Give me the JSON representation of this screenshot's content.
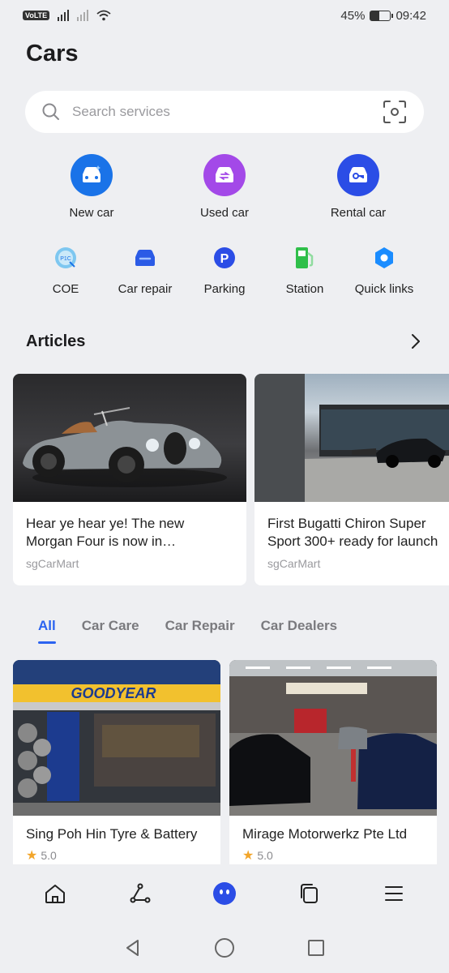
{
  "status_bar": {
    "battery_percent": "45%",
    "time": "09:42",
    "volte": "VoLTE",
    "battery_level": 0.45
  },
  "page": {
    "title": "Cars"
  },
  "search": {
    "placeholder": "Search services"
  },
  "primary_services": [
    {
      "label": "New car",
      "icon": "new-car-icon",
      "color": "#1a73e8"
    },
    {
      "label": "Used car",
      "icon": "used-car-icon",
      "color": "#a349e8"
    },
    {
      "label": "Rental car",
      "icon": "rental-car-icon",
      "color": "#2b4de6"
    }
  ],
  "secondary_services": [
    {
      "label": "COE",
      "icon": "coe-icon"
    },
    {
      "label": "Car repair",
      "icon": "car-repair-icon"
    },
    {
      "label": "Parking",
      "icon": "parking-icon"
    },
    {
      "label": "Station",
      "icon": "fuel-station-icon"
    },
    {
      "label": "Quick links",
      "icon": "quick-links-icon"
    }
  ],
  "articles": {
    "title": "Articles",
    "items": [
      {
        "title_line1": "Hear ye hear ye! The new",
        "title_line2": "Morgan Four is now in…",
        "source": "sgCarMart"
      },
      {
        "title_line1": "First Bugatti Chiron Super",
        "title_line2": "Sport 300+ ready for launch",
        "source": "sgCarMart"
      }
    ]
  },
  "tabs": [
    {
      "label": "All",
      "active": true
    },
    {
      "label": "Car Care"
    },
    {
      "label": "Car Repair"
    },
    {
      "label": "Car Dealers"
    }
  ],
  "shops": [
    {
      "name": "Sing Poh Hin Tyre & Battery",
      "rating": "5.0",
      "sign_text": "GOODYEAR"
    },
    {
      "name": "Mirage Motorwerkz Pte Ltd",
      "rating": "5.0"
    }
  ],
  "colors": {
    "accent": "#2b63f0",
    "star": "#f2a52a"
  }
}
